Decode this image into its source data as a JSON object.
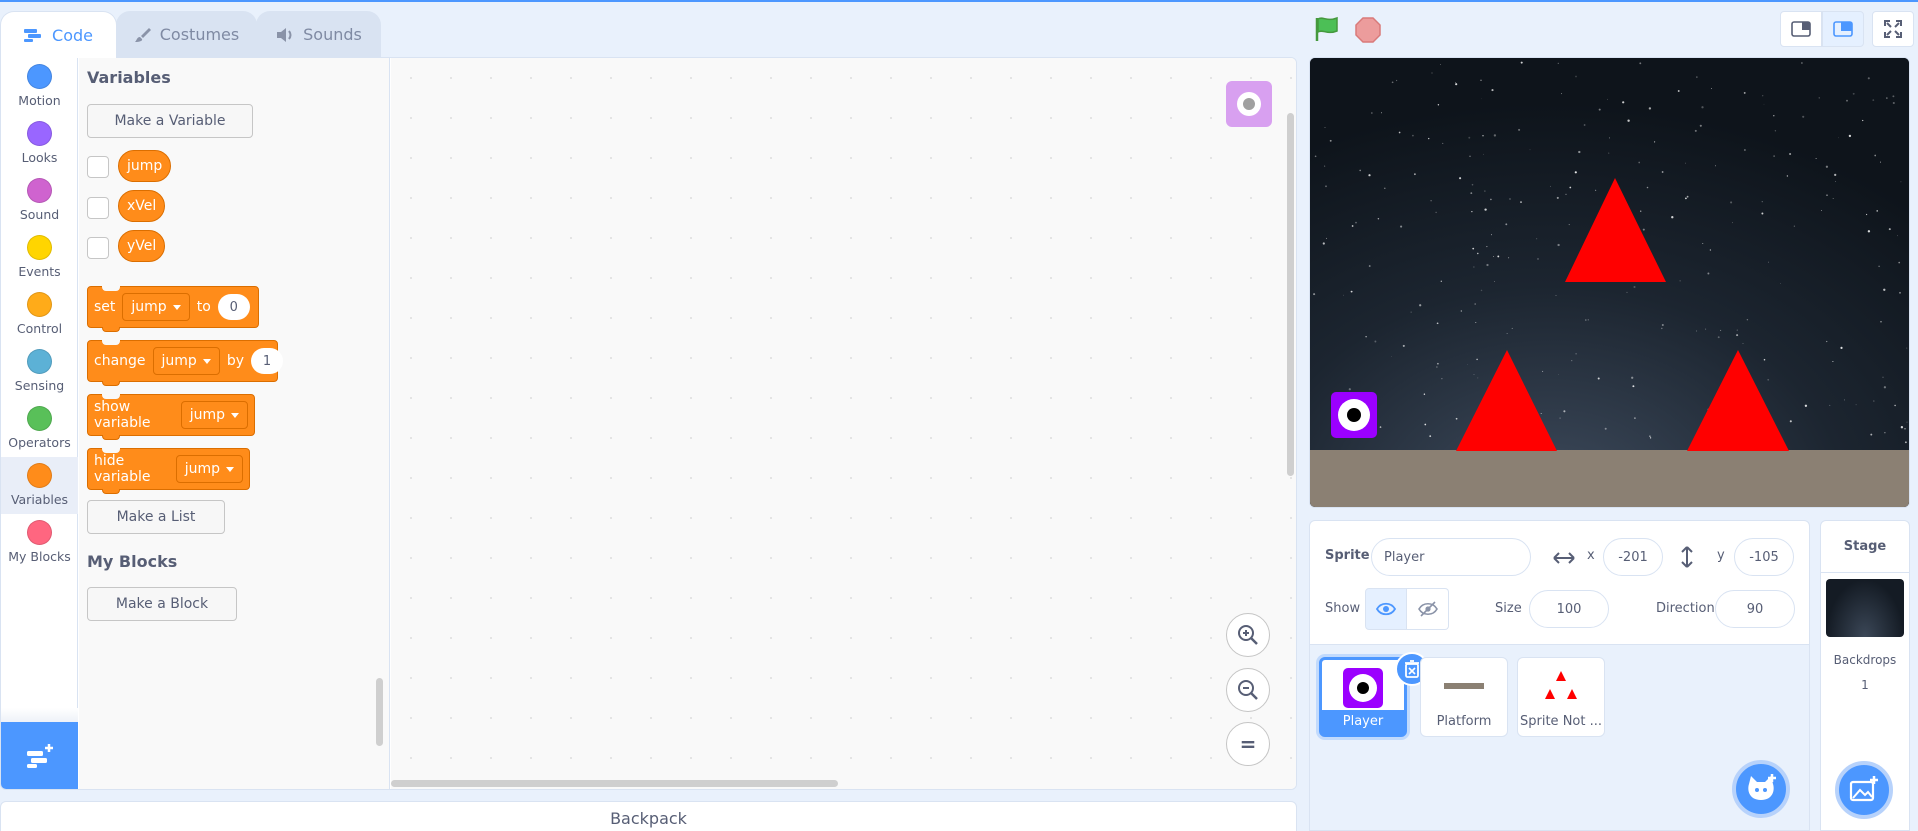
{
  "tabs": [
    {
      "label": "Code",
      "icon": "code-icon",
      "active": true
    },
    {
      "label": "Costumes",
      "icon": "brush-icon",
      "active": false
    },
    {
      "label": "Sounds",
      "icon": "speaker-icon",
      "active": false
    }
  ],
  "categories": [
    {
      "label": "Motion",
      "color": "#4c97ff"
    },
    {
      "label": "Looks",
      "color": "#9966ff"
    },
    {
      "label": "Sound",
      "color": "#cf63cf"
    },
    {
      "label": "Events",
      "color": "#ffd500"
    },
    {
      "label": "Control",
      "color": "#ffab19"
    },
    {
      "label": "Sensing",
      "color": "#5cb1d6"
    },
    {
      "label": "Operators",
      "color": "#59c059"
    },
    {
      "label": "Variables",
      "color": "#ff8c1a",
      "selected": true
    },
    {
      "label": "My Blocks",
      "color": "#ff6680"
    }
  ],
  "palette": {
    "variables_heading": "Variables",
    "make_variable": "Make a Variable",
    "variables": [
      "jump",
      "xVel",
      "yVel"
    ],
    "blocks": {
      "set": {
        "label": "set",
        "var": "jump",
        "to": "to",
        "value": "0"
      },
      "change": {
        "label": "change",
        "var": "jump",
        "by": "by",
        "value": "1"
      },
      "show": {
        "label": "show variable",
        "var": "jump"
      },
      "hide": {
        "label": "hide variable",
        "var": "jump"
      }
    },
    "make_list": "Make a List",
    "myblocks_heading": "My Blocks",
    "make_block": "Make a Block"
  },
  "zoom": {
    "reset_label": "="
  },
  "backpack": {
    "label": "Backpack"
  },
  "sprite_info": {
    "sprite_label": "Sprite",
    "name": "Player",
    "x_label": "x",
    "x": "-201",
    "y_label": "y",
    "y": "-105",
    "show_label": "Show",
    "size_label": "Size",
    "size": "100",
    "direction_label": "Direction",
    "direction": "90"
  },
  "sprites": [
    {
      "name": "Player",
      "selected": true
    },
    {
      "name": "Platform",
      "selected": false
    },
    {
      "name": "Sprite Not ...",
      "selected": false
    }
  ],
  "stage_pane": {
    "title": "Stage",
    "backdrops_label": "Backdrops",
    "backdrops_count": "1"
  },
  "colors": {
    "accent": "#4c97ff",
    "variables": "#ff8c1a",
    "ground": "#8b8073",
    "spike": "#ff0000"
  }
}
